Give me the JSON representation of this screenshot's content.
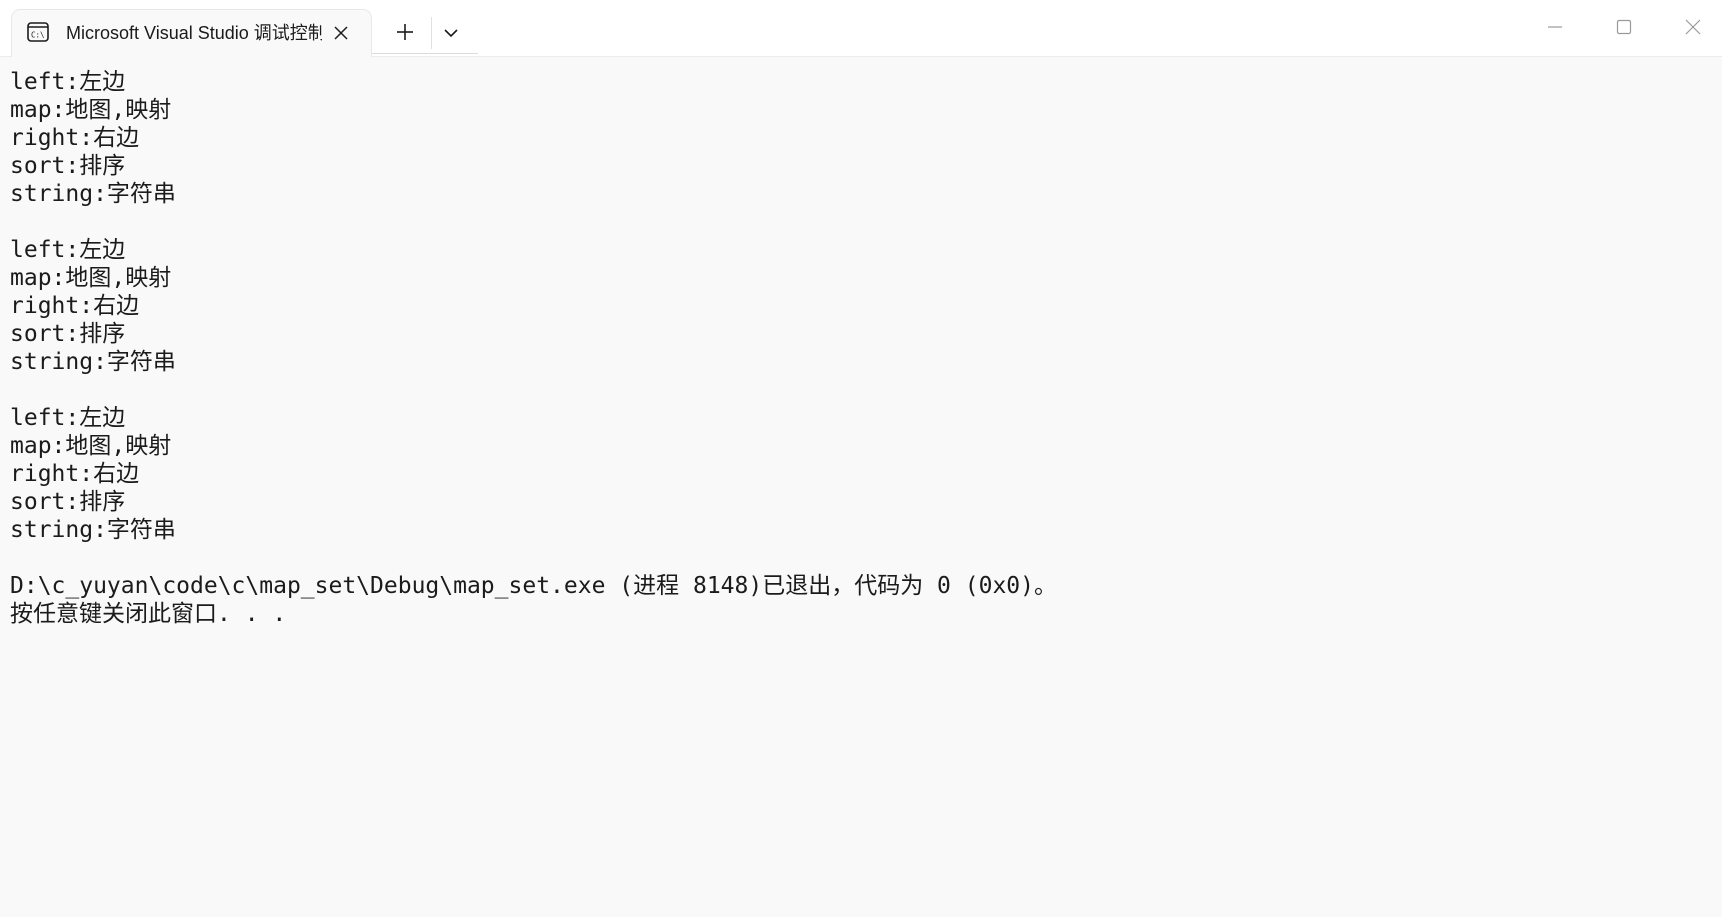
{
  "titlebar": {
    "tab_title": "Microsoft Visual Studio 调试控制台",
    "tab_icon": "console-icon",
    "close_icon": "close-icon",
    "new_tab_icon": "plus-icon",
    "dropdown_icon": "chevron-down-icon",
    "window_controls": [
      "minimize-icon",
      "maximize-icon",
      "close-icon"
    ]
  },
  "console": {
    "lines": [
      "left:左边",
      "map:地图,映射",
      "right:右边",
      "sort:排序",
      "string:字符串",
      "",
      "left:左边",
      "map:地图,映射",
      "right:右边",
      "sort:排序",
      "string:字符串",
      "",
      "left:左边",
      "map:地图,映射",
      "right:右边",
      "sort:排序",
      "string:字符串",
      "",
      "D:\\c_yuyan\\code\\c\\map_set\\Debug\\map_set.exe (进程 8148)已退出，代码为 0 (0x0)。",
      "按任意键关闭此窗口. . ."
    ]
  },
  "colors": {
    "titlebar_bg": "#ffffff",
    "console_bg": "#f9f9f9",
    "text": "#1b1b1b"
  }
}
